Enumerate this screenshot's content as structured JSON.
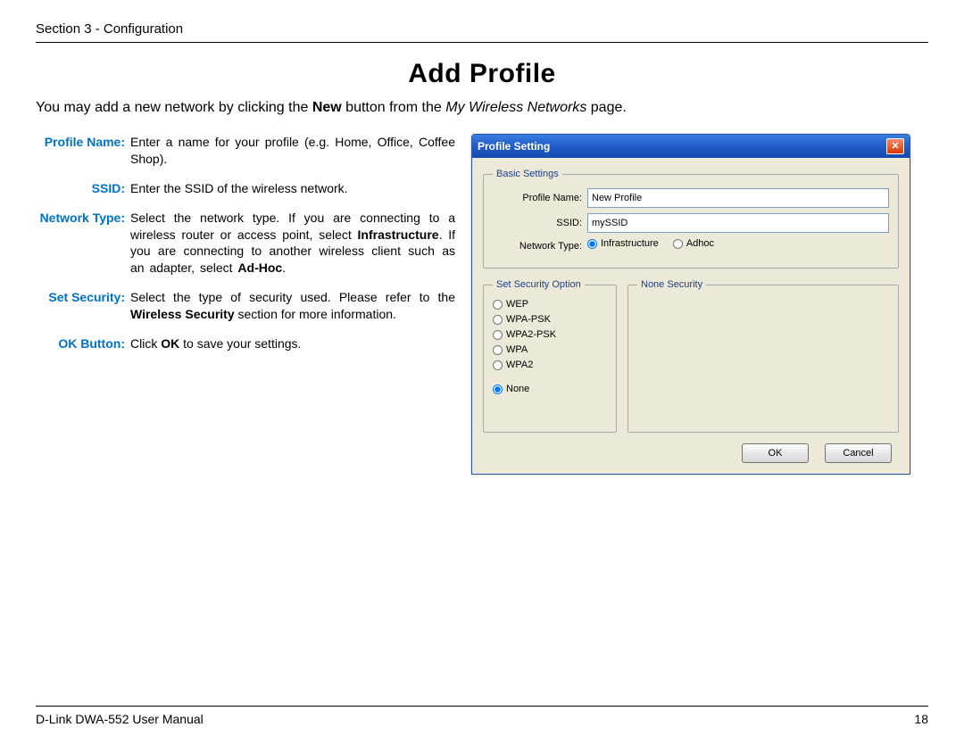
{
  "header": {
    "section": "Section 3 - Configuration"
  },
  "title": "Add Profile",
  "intro": {
    "pre": "You may add a new network by clicking the ",
    "bold": "New",
    "mid": " button from the ",
    "ital": "My Wireless Networks",
    "post": " page."
  },
  "defs": {
    "profile_name": {
      "label": "Profile Name:",
      "text": "Enter a name for your profile (e.g. Home, Office, Coffee Shop)."
    },
    "ssid": {
      "label": "SSID:",
      "text": "Enter the SSID of the wireless network."
    },
    "network_type": {
      "label": "Network Type:",
      "t1": "Select the network type. If you are connecting to a wireless router or access point, select ",
      "b1": "Infrastructure",
      "t2": ". If you are connecting to another wireless client such as an adapter, select ",
      "b2": "Ad-Hoc",
      "t3": "."
    },
    "set_security": {
      "label": "Set Security:",
      "t1": "Select the type of security used. Please refer to the ",
      "b1": "Wireless Security",
      "t2": " section for more information."
    },
    "ok_button": {
      "label": "OK Button:",
      "t1": "Click ",
      "b1": "OK",
      "t2": " to save your settings."
    }
  },
  "dialog": {
    "title": "Profile Setting",
    "basic_legend": "Basic Settings",
    "profile_name_label": "Profile Name:",
    "profile_name_value": "New Profile",
    "ssid_label": "SSID:",
    "ssid_value": "mySSID",
    "network_type_label": "Network Type:",
    "radio_infrastructure": "Infrastructure",
    "radio_adhoc": "Adhoc",
    "sec_legend": "Set Security Option",
    "none_legend": "None Security",
    "opts": {
      "wep": "WEP",
      "wpa_psk": "WPA-PSK",
      "wpa2_psk": "WPA2-PSK",
      "wpa": "WPA",
      "wpa2": "WPA2",
      "none": "None"
    },
    "ok": "OK",
    "cancel": "Cancel"
  },
  "footer": {
    "left": "D-Link DWA-552 User Manual",
    "right": "18"
  }
}
